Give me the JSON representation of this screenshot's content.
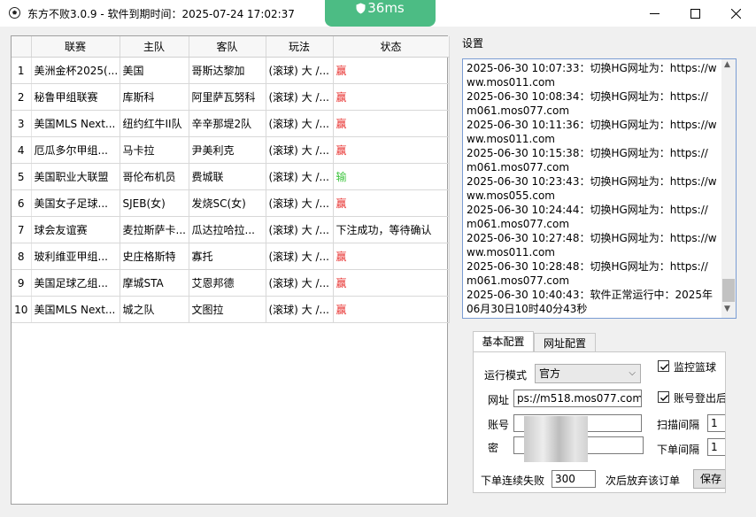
{
  "window": {
    "title": "东方不败3.0.9 - 软件到期时间：2025-07-24 17:02:37",
    "ping": "36ms",
    "icon": "soccer-ball-icon"
  },
  "grid": {
    "columns": [
      "联赛",
      "主队",
      "客队",
      "玩法",
      "状态"
    ],
    "rows": [
      {
        "num": "1",
        "league": "美洲金杯2025(...",
        "home": "美国",
        "away": "哥斯达黎加",
        "play": "(滚球) 大 /...",
        "status": "赢",
        "status_color": "#e8312f"
      },
      {
        "num": "2",
        "league": "秘鲁甲组联赛",
        "home": "库斯科",
        "away": "阿里萨瓦努科",
        "play": "(滚球) 大 /...",
        "status": "赢",
        "status_color": "#e8312f"
      },
      {
        "num": "3",
        "league": "美国MLS Next...",
        "home": "纽约红牛II队",
        "away": "辛辛那堤2队",
        "play": "(滚球) 大 /...",
        "status": "赢",
        "status_color": "#e8312f"
      },
      {
        "num": "4",
        "league": "厄瓜多尔甲组...",
        "home": "马卡拉",
        "away": "尹美利克",
        "play": "(滚球) 大 /...",
        "status": "赢",
        "status_color": "#e8312f"
      },
      {
        "num": "5",
        "league": "美国职业大联盟",
        "home": "哥伦布机员",
        "away": "费城联",
        "play": "(滚球) 大 /...",
        "status": "输",
        "status_color": "#3cc43c"
      },
      {
        "num": "6",
        "league": "美国女子足球...",
        "home": "SJEB(女)",
        "away": "发烧SC(女)",
        "play": "(滚球) 大 /...",
        "status": "赢",
        "status_color": "#e8312f"
      },
      {
        "num": "7",
        "league": "球会友谊赛",
        "home": "麦拉斯萨卡...",
        "away": "瓜达拉哈拉...",
        "play": "(滚球) 大 /...",
        "status": "下注成功，等待确认",
        "status_color": "#000000"
      },
      {
        "num": "8",
        "league": "玻利维亚甲组...",
        "home": "史庄格斯特",
        "away": "寡托",
        "play": "(滚球) 大 /...",
        "status": "赢",
        "status_color": "#e8312f"
      },
      {
        "num": "9",
        "league": "美国足球乙组...",
        "home": "摩城STA",
        "away": "艾恩邦德",
        "play": "(滚球) 大 /...",
        "status": "赢",
        "status_color": "#e8312f"
      },
      {
        "num": "10",
        "league": "美国MLS Next...",
        "home": "城之队",
        "away": "文图拉",
        "play": "(滚球) 大 /...",
        "status": "赢",
        "status_color": "#e8312f"
      }
    ]
  },
  "settings": {
    "label": "设置",
    "log": "2025-06-30 10:07:33：切换HG网址为：https://www.mos011.com\n2025-06-30 10:08:34：切换HG网址为：https://m061.mos077.com\n2025-06-30 10:11:36：切换HG网址为：https://www.mos011.com\n2025-06-30 10:15:38：切换HG网址为：https://m061.mos077.com\n2025-06-30 10:23:43：切换HG网址为：https://www.mos055.com\n2025-06-30 10:24:44：切换HG网址为：https://m061.mos077.com\n2025-06-30 10:27:48：切换HG网址为：https://www.mos011.com\n2025-06-30 10:28:48：切换HG网址为：https://m061.mos077.com\n2025-06-30 10:40:43：软件正常运行中：2025年06月30日10时40分43秒"
  },
  "tabs": [
    "基本配置",
    "网址配置"
  ],
  "form": {
    "mode_label": "运行模式",
    "mode_value": "官方",
    "url_label": "网址",
    "url_value": "ps://m518.mos077.com",
    "account_label": "账号",
    "password_label": "密",
    "monitor_basketball": "监控篮球",
    "account_logout": "账号登出后",
    "scan_interval_label": "扫描间隔",
    "scan_interval_value": "1",
    "order_interval_label": "下单间隔",
    "order_interval_value": "1",
    "fail_label": "下单连续失败",
    "fail_value": "300",
    "fail_suffix": "次后放弃该订单",
    "save": "保存"
  }
}
